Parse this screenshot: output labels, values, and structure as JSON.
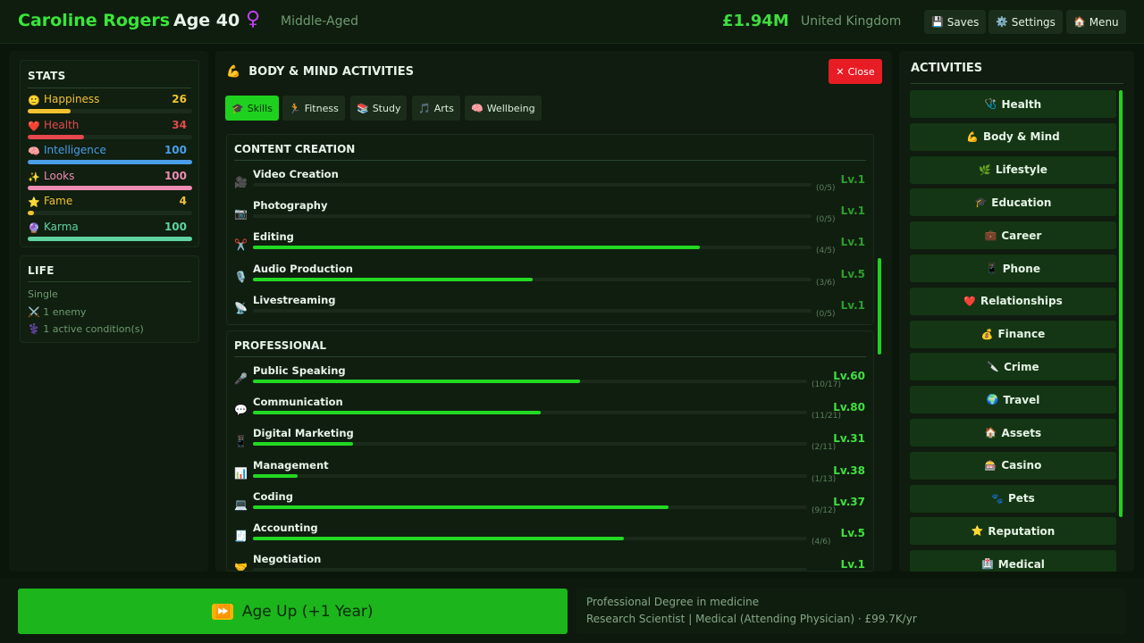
{
  "header": {
    "name": "Caroline Rogers",
    "age": "Age 40",
    "gender_icon": "♀",
    "life_stage": "Middle-Aged",
    "money": "£1.94M",
    "country": "United Kingdom",
    "buttons": [
      {
        "icon": "💾",
        "label": "Saves",
        "icon_name": "floppy-disk-icon"
      },
      {
        "icon": "⚙️",
        "label": "Settings",
        "icon_name": "gear-icon"
      },
      {
        "icon": "🏠",
        "label": "Menu",
        "icon_name": "home-icon"
      }
    ]
  },
  "stats": {
    "title": "STATS",
    "items": [
      {
        "icon": "🙂",
        "label": "Happiness",
        "value": "26",
        "fraction": 0.26,
        "color": "#f2c231"
      },
      {
        "icon": "❤️",
        "label": "Health",
        "value": "34",
        "fraction": 0.34,
        "color": "#e5484d"
      },
      {
        "icon": "🧠",
        "label": "Intelligence",
        "value": "100",
        "fraction": 1.0,
        "color": "#4a9ee8"
      },
      {
        "icon": "✨",
        "label": "Looks",
        "value": "100",
        "fraction": 1.0,
        "color": "#f08cb4"
      },
      {
        "icon": "⭐",
        "label": "Fame",
        "value": "4",
        "fraction": 0.04,
        "color": "#f2c231"
      },
      {
        "icon": "🔮",
        "label": "Karma",
        "value": "100",
        "fraction": 1.0,
        "color": "#5fd3a0"
      }
    ]
  },
  "life": {
    "title": "LIFE",
    "status": "Single",
    "enemies": {
      "icon": "⚔️",
      "text": "1 enemy"
    },
    "conditions": {
      "icon": "⚕️",
      "text": "1 active condition(s)"
    }
  },
  "activity_panel": {
    "icon": "💪",
    "title": "BODY & MIND ACTIVITIES",
    "close_label": "Close",
    "close_icon": "✕",
    "tabs": [
      {
        "icon": "🎓",
        "label": "Skills",
        "active": true
      },
      {
        "icon": "🏃",
        "label": "Fitness",
        "active": false
      },
      {
        "icon": "📚",
        "label": "Study",
        "active": false
      },
      {
        "icon": "🎵",
        "label": "Arts",
        "active": false
      },
      {
        "icon": "🧠",
        "label": "Wellbeing",
        "active": false
      }
    ],
    "sections": [
      {
        "title": "CONTENT CREATION",
        "skills": [
          {
            "icon": "🎥",
            "name": "Video Creation",
            "level": "Lv.1",
            "progress": "(0/5)",
            "fraction": 0.0
          },
          {
            "icon": "📷",
            "name": "Photography",
            "level": "Lv.1",
            "progress": "(0/5)",
            "fraction": 0.0
          },
          {
            "icon": "✂️",
            "name": "Editing",
            "level": "Lv.1",
            "progress": "(4/5)",
            "fraction": 0.8
          },
          {
            "icon": "🎙️",
            "name": "Audio Production",
            "level": "Lv.5",
            "progress": "(3/6)",
            "fraction": 0.5
          },
          {
            "icon": "📡",
            "name": "Livestreaming",
            "level": "Lv.1",
            "progress": "(0/5)",
            "fraction": 0.0
          }
        ]
      },
      {
        "title": "PROFESSIONAL",
        "skills": [
          {
            "icon": "🎤",
            "name": "Public Speaking",
            "level": "Lv.60",
            "progress": "(10/17)",
            "fraction": 0.59
          },
          {
            "icon": "💬",
            "name": "Communication",
            "level": "Lv.80",
            "progress": "(11/21)",
            "fraction": 0.52
          },
          {
            "icon": "📱",
            "name": "Digital Marketing",
            "level": "Lv.31",
            "progress": "(2/11)",
            "fraction": 0.18
          },
          {
            "icon": "📊",
            "name": "Management",
            "level": "Lv.38",
            "progress": "(1/13)",
            "fraction": 0.08
          },
          {
            "icon": "💻",
            "name": "Coding",
            "level": "Lv.37",
            "progress": "(9/12)",
            "fraction": 0.75
          },
          {
            "icon": "🧾",
            "name": "Accounting",
            "level": "Lv.5",
            "progress": "(4/6)",
            "fraction": 0.67
          },
          {
            "icon": "🤝",
            "name": "Negotiation",
            "level": "Lv.1",
            "progress": "",
            "fraction": 0.0
          }
        ]
      }
    ]
  },
  "activities": {
    "title": "ACTIVITIES",
    "items": [
      {
        "icon": "🩺",
        "label": "Health"
      },
      {
        "icon": "💪",
        "label": "Body & Mind"
      },
      {
        "icon": "🌿",
        "label": "Lifestyle"
      },
      {
        "icon": "🎓",
        "label": "Education"
      },
      {
        "icon": "💼",
        "label": "Career"
      },
      {
        "icon": "📱",
        "label": "Phone"
      },
      {
        "icon": "❤️",
        "label": "Relationships"
      },
      {
        "icon": "💰",
        "label": "Finance"
      },
      {
        "icon": "🔪",
        "label": "Crime"
      },
      {
        "icon": "🌍",
        "label": "Travel"
      },
      {
        "icon": "🏠",
        "label": "Assets"
      },
      {
        "icon": "🎰",
        "label": "Casino"
      },
      {
        "icon": "🐾",
        "label": "Pets"
      },
      {
        "icon": "⭐",
        "label": "Reputation"
      },
      {
        "icon": "🏥",
        "label": "Medical"
      }
    ]
  },
  "footer": {
    "age_up_icon": "⏩",
    "age_up_label": "Age Up (+1 Year)",
    "degree": "Professional Degree in medicine",
    "job": "Research Scientist | Medical (Attending Physician) · £99.7K/yr"
  }
}
